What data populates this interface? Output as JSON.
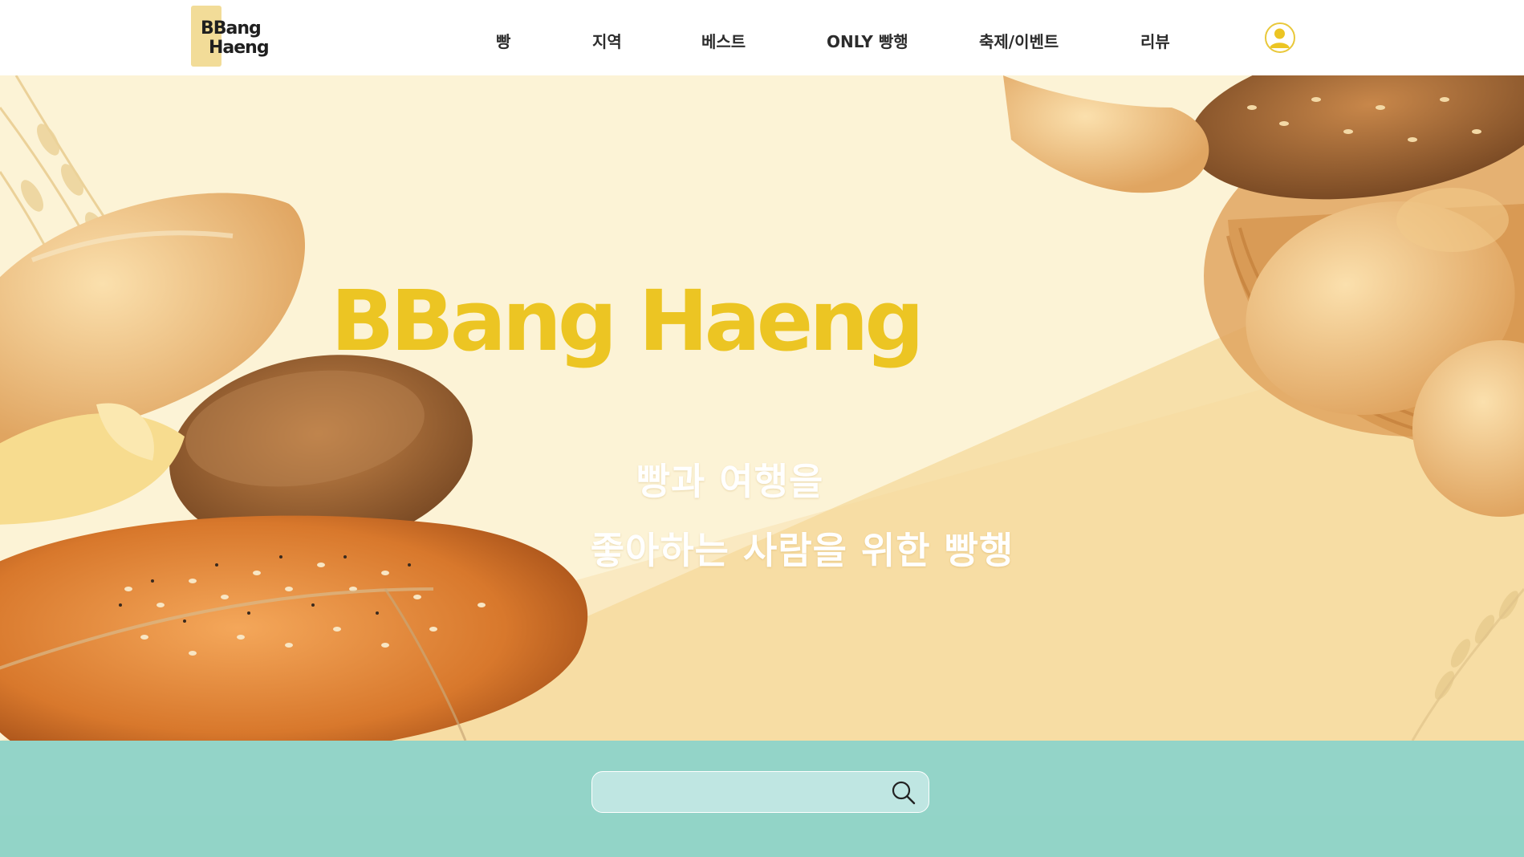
{
  "header": {
    "logo_line1": "BBang",
    "logo_line2": "Haeng",
    "nav": [
      {
        "label": "빵"
      },
      {
        "label": "지역"
      },
      {
        "label": "베스트"
      },
      {
        "label": "ONLY 빵행"
      },
      {
        "label": "축제/이벤트"
      },
      {
        "label": "리뷰"
      }
    ],
    "profile_icon": "user-icon"
  },
  "hero": {
    "title": "BBang Haeng",
    "subtitle_line1": "빵과 여행을",
    "subtitle_line2": "좋아하는 사람을 위한 빵행"
  },
  "search": {
    "value": "",
    "placeholder": "",
    "icon": "search-icon"
  },
  "colors": {
    "accent_yellow": "#ecc523",
    "logo_block": "#f2dc98",
    "search_band": "#80cec4",
    "hero_background": "#fcf3d6"
  }
}
